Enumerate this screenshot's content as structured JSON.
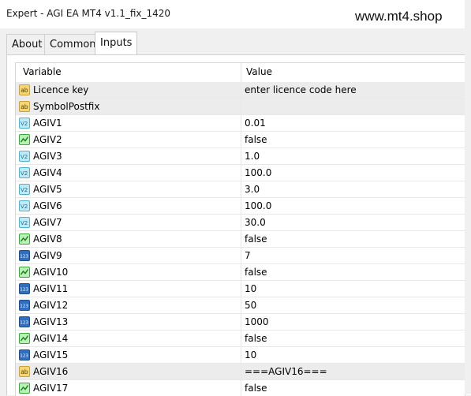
{
  "window": {
    "title": "Expert - AGI EA MT4 v1.1_fix_1420"
  },
  "watermark": "www.mt4.shop",
  "tabs": [
    {
      "label": "About",
      "active": false
    },
    {
      "label": "Common",
      "active": false
    },
    {
      "label": "Inputs",
      "active": true
    }
  ],
  "grid": {
    "headers": {
      "variable": "Variable",
      "value": "Value"
    },
    "rows": [
      {
        "icon": "string-ab-icon",
        "name": "Licence key",
        "value": "enter licence code here"
      },
      {
        "icon": "string-ab-icon",
        "name": "SymbolPostfix",
        "value": ""
      },
      {
        "icon": "double-v2-icon",
        "name": "AGIV1",
        "value": "0.01"
      },
      {
        "icon": "bool-icon",
        "name": "AGIV2",
        "value": "false"
      },
      {
        "icon": "double-v2-icon",
        "name": "AGIV3",
        "value": "1.0"
      },
      {
        "icon": "double-v2-icon",
        "name": "AGIV4",
        "value": "100.0"
      },
      {
        "icon": "double-v2-icon",
        "name": "AGIV5",
        "value": "3.0"
      },
      {
        "icon": "double-v2-icon",
        "name": "AGIV6",
        "value": "100.0"
      },
      {
        "icon": "double-v2-icon",
        "name": "AGIV7",
        "value": "30.0"
      },
      {
        "icon": "bool-icon",
        "name": "AGIV8",
        "value": "false"
      },
      {
        "icon": "int-123-icon",
        "name": "AGIV9",
        "value": "7"
      },
      {
        "icon": "bool-icon",
        "name": "AGIV10",
        "value": "false"
      },
      {
        "icon": "int-123-icon",
        "name": "AGIV11",
        "value": "10"
      },
      {
        "icon": "int-123-icon",
        "name": "AGIV12",
        "value": "50"
      },
      {
        "icon": "int-123-icon",
        "name": "AGIV13",
        "value": "1000"
      },
      {
        "icon": "bool-icon",
        "name": "AGIV14",
        "value": "false"
      },
      {
        "icon": "int-123-icon",
        "name": "AGIV15",
        "value": "10"
      },
      {
        "icon": "string-ab-icon",
        "name": "AGIV16",
        "value": "===AGIV16==="
      },
      {
        "icon": "bool-icon",
        "name": "AGIV17",
        "value": "false"
      }
    ]
  },
  "colors": {
    "row_alt_gray": "#ececec",
    "header_bg": "#ffffff"
  }
}
